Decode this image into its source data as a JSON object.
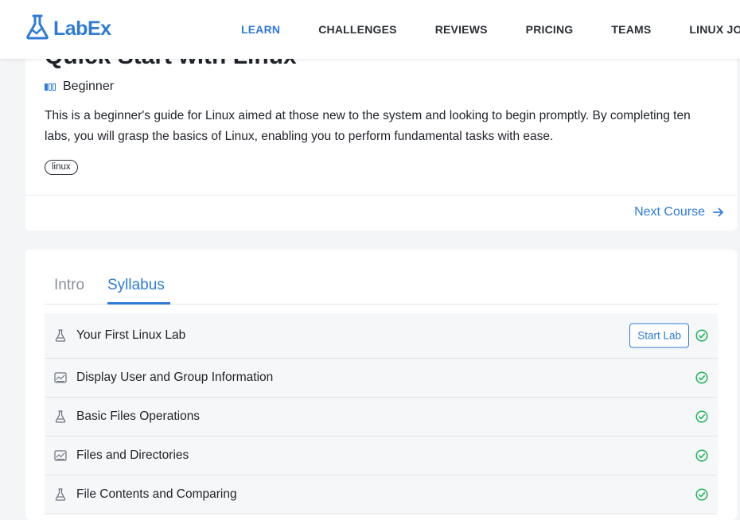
{
  "brand": {
    "name": "LabEx",
    "color": "#2e7bd6"
  },
  "nav": [
    {
      "label": "LEARN",
      "active": true
    },
    {
      "label": "CHALLENGES"
    },
    {
      "label": "REVIEWS"
    },
    {
      "label": "PRICING"
    },
    {
      "label": "TEAMS"
    },
    {
      "label": "LINUX JOU"
    }
  ],
  "course": {
    "title": "Quick Start with Linux",
    "level": "Beginner",
    "description": "This is a beginner's guide for Linux aimed at those new to the system and looking to begin promptly. By completing ten labs, you will grasp the basics of Linux, enabling you to perform fundamental tasks with ease.",
    "tag": "linux",
    "next_label": "Next Course"
  },
  "tabs": [
    {
      "label": "Intro"
    },
    {
      "label": "Syllabus",
      "active": true
    }
  ],
  "syllabus": [
    {
      "label": "Your First Linux Lab",
      "icon": "flask-icon",
      "action": "Start Lab",
      "completed": true
    },
    {
      "label": "Display User and Group Information",
      "icon": "challenge-icon",
      "completed": true
    },
    {
      "label": "Basic Files Operations",
      "icon": "flask-icon",
      "completed": true
    },
    {
      "label": "Files and Directories",
      "icon": "challenge-icon",
      "completed": true
    },
    {
      "label": "File Contents and Comparing",
      "icon": "flask-icon",
      "completed": true
    }
  ],
  "colors": {
    "accent": "#2e7bd6",
    "success": "#21b35a"
  }
}
